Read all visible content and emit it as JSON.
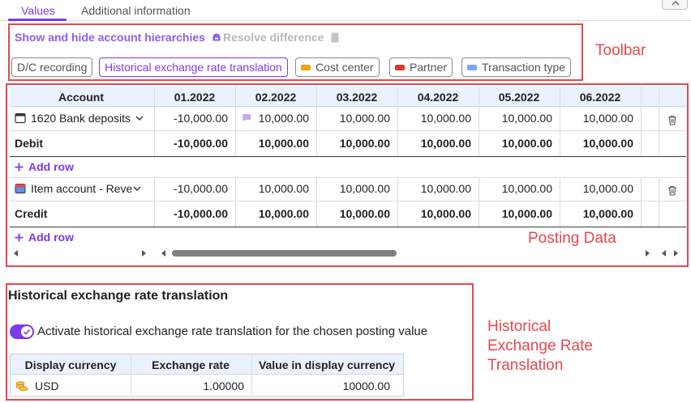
{
  "tabs": [
    {
      "label": "Values",
      "active": true
    },
    {
      "label": "Additional information",
      "active": false
    }
  ],
  "annotations": {
    "toolbar": "Toolbar",
    "posting": "Posting Data",
    "historical": "Historical\nExchange Rate\nTranslation"
  },
  "toolbar": {
    "show_hide": "Show and hide account hierarchies",
    "resolve": "Resolve difference",
    "chips": [
      {
        "label": "D/C recording",
        "selected": false,
        "color": null
      },
      {
        "label": "Historical exchange rate translation",
        "selected": true,
        "color": null
      },
      {
        "label": "Cost center",
        "selected": false,
        "color": "#f0a30a"
      },
      {
        "label": "Partner",
        "selected": false,
        "color": "#d93a2b"
      },
      {
        "label": "Transaction type",
        "selected": false,
        "color": "#7fa7f5"
      }
    ]
  },
  "grid": {
    "account_header": "Account",
    "periods": [
      "01.2022",
      "02.2022",
      "03.2022",
      "04.2022",
      "05.2022",
      "06.2022"
    ],
    "sections": [
      {
        "account": "1620 Bank deposits",
        "icon": "calendar-icon",
        "values": [
          "-10,000.00",
          "10,000.00",
          "10,000.00",
          "10,000.00",
          "10,000.00",
          "10,000.00"
        ],
        "total_label": "Debit",
        "totals": [
          "-10,000.00",
          "10,000.00",
          "10,000.00",
          "10,000.00",
          "10,000.00",
          "10,000.00"
        ],
        "add_row": "Add row"
      },
      {
        "account": "Item account - Revenue",
        "icon": "item-account-icon",
        "values": [
          "-10,000.00",
          "10,000.00",
          "10,000.00",
          "10,000.00",
          "10,000.00",
          "10,000.00"
        ],
        "total_label": "Credit",
        "totals": [
          "-10,000.00",
          "10,000.00",
          "10,000.00",
          "10,000.00",
          "10,000.00",
          "10,000.00"
        ],
        "add_row": "Add row"
      }
    ]
  },
  "historical": {
    "title": "Historical exchange rate translation",
    "toggle_label": "Activate historical exchange rate translation for the chosen posting value",
    "toggle_on": true,
    "headers": [
      "Display currency",
      "Exchange rate",
      "Value in display currency"
    ],
    "row": {
      "currency": "USD",
      "rate": "1.00000",
      "value": "10000.00"
    }
  }
}
